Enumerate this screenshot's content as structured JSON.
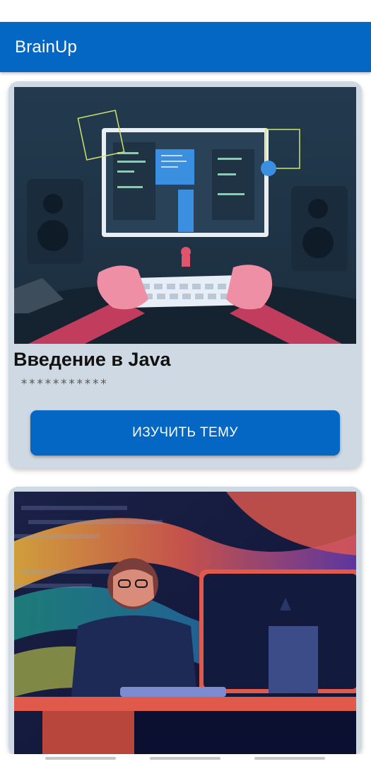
{
  "app": {
    "title": "BrainUp"
  },
  "cards": [
    {
      "title": "Введение в Java",
      "subtitle": "***********",
      "button_label": "ИЗУЧИТЬ ТЕМУ",
      "image_icon": "programmer-at-monitor-illustration"
    },
    {
      "image_icon": "developer-at-computer-illustration"
    }
  ],
  "colors": {
    "accent": "#0567c4",
    "card_background": "#cfd9e3",
    "button_text": "#ffffff"
  }
}
